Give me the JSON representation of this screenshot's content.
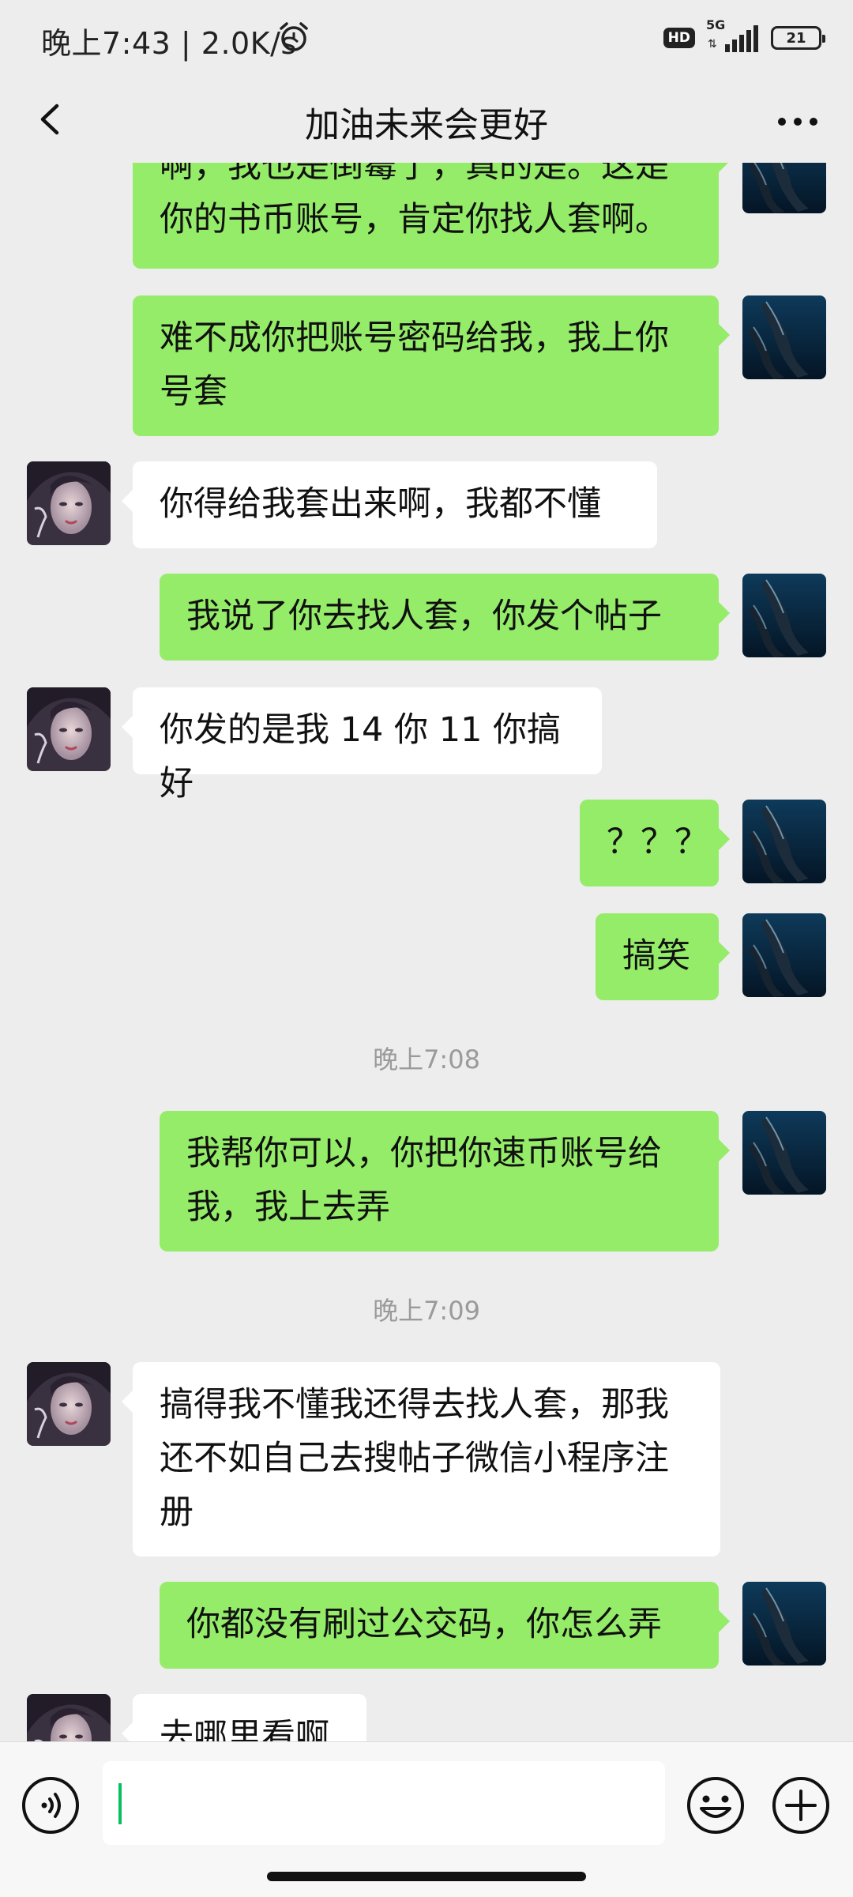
{
  "status_bar": {
    "time_speed": "晚上7:43 | 2.0K/s",
    "hd_badge": "HD",
    "network": "5G",
    "battery": "21"
  },
  "header": {
    "title": "加油未来会更好"
  },
  "messages": [
    {
      "from": "me",
      "text": "啊，我也是倒霉了，真的是。这是\n你的书币账号，肯定你找人套啊。"
    },
    {
      "from": "me",
      "text": "难不成你把账号密码给我，我上你\n号套"
    },
    {
      "from": "them",
      "text": "你得给我套出来啊，我都不懂"
    },
    {
      "from": "me",
      "text": "我说了你去找人套，你发个帖子"
    },
    {
      "from": "them",
      "text": "你发的是我 14 你 11 你搞好"
    },
    {
      "from": "me",
      "text": "？？？"
    },
    {
      "from": "me",
      "text": "搞笑"
    },
    {
      "timestamp": "晚上7:08"
    },
    {
      "from": "me",
      "text": "我帮你可以，你把你速币账号给\n我，我上去弄"
    },
    {
      "timestamp": "晚上7:09"
    },
    {
      "from": "them",
      "text": "搞得我不懂我还得去找人套，那我\n还不如自己去搜帖子微信小程序注\n册"
    },
    {
      "from": "me",
      "text": "你都没有刷过公交码，你怎么弄"
    },
    {
      "from": "them",
      "text": "去哪里看啊"
    }
  ],
  "input": {
    "value": ""
  },
  "icons": {
    "back": "back-arrow-icon",
    "more": "more-dots-icon",
    "voice": "voice-icon",
    "emoji": "emoji-icon",
    "plus": "plus-icon"
  },
  "colors": {
    "my_bubble": "#95ec69",
    "their_bubble": "#ffffff",
    "background": "#ededed",
    "caret": "#07c160"
  }
}
